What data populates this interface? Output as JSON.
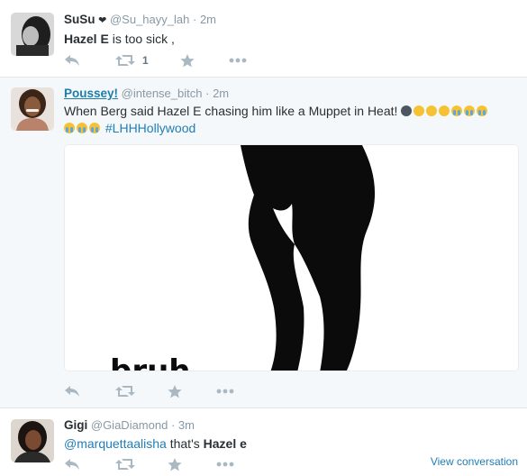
{
  "tweets": [
    {
      "fullname": "SuSu",
      "heart": "❤",
      "username": "@Su_hayy_lah",
      "time": "2m",
      "sep": "·",
      "text_bold": "Hazel E",
      "text_rest": " is too sick ,",
      "retweet_count": "1",
      "avatar": "avatar-bw-photo"
    },
    {
      "fullname": "Poussey!",
      "username": "@intense_bitch",
      "time": "2m",
      "sep": "·",
      "text": "When Berg said Hazel E chasing him like a Muppet in Heat!",
      "hashtag": "#LHHHollywood",
      "avatar": "avatar-smiling-woman",
      "media_icon": "silhouette-legs-image"
    },
    {
      "fullname": "Gigi",
      "username": "@GiaDiamond",
      "time": "3m",
      "sep": "·",
      "mention": "@marquettaalisha",
      "text_mid": " that's ",
      "text_bold": "Hazel e",
      "view_conversation": "View conversation",
      "avatar": "avatar-woman-selfie"
    }
  ],
  "colors": {
    "link": "#1f7eb4",
    "muted": "#8899a6",
    "text": "#292f33",
    "highlight_bg": "#f5f8fa",
    "action_icon": "#aab8c2"
  },
  "icons": [
    "reply-icon",
    "retweet-icon",
    "favorite-icon",
    "more-icon"
  ]
}
